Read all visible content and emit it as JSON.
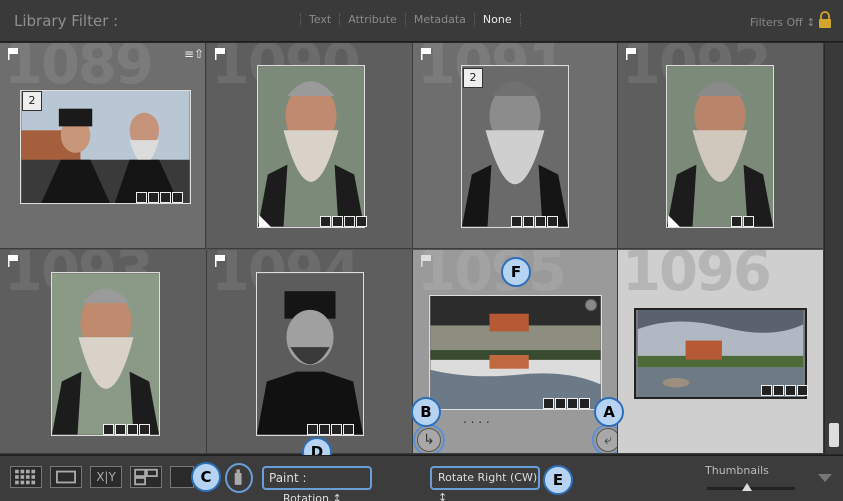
{
  "filterbar": {
    "title": "Library Filter :",
    "tabs": [
      {
        "label": "Text",
        "active": false
      },
      {
        "label": "Attribute",
        "active": false
      },
      {
        "label": "Metadata",
        "active": false
      },
      {
        "label": "None",
        "active": true
      }
    ],
    "filters_off": "Filters Off ↕",
    "lock_icon": "lock-icon"
  },
  "grid": {
    "cells": [
      {
        "index": "1089",
        "stack_count": "2",
        "tone": "light"
      },
      {
        "index": "1090",
        "stack_count": "",
        "tone": "dark"
      },
      {
        "index": "1091",
        "stack_count": "2",
        "tone": "light"
      },
      {
        "index": "1092",
        "stack_count": "",
        "tone": "dark"
      },
      {
        "index": "1093",
        "stack_count": "",
        "tone": "dark"
      },
      {
        "index": "1094",
        "stack_count": "",
        "tone": "dark"
      },
      {
        "index": "1095",
        "stack_count": "",
        "tone": "hover"
      },
      {
        "index": "1096",
        "stack_count": "",
        "tone": "selected"
      }
    ]
  },
  "callouts": {
    "a": "A",
    "b": "B",
    "c": "C",
    "d": "D",
    "e": "E",
    "f": "F"
  },
  "misc": {
    "ellipsis": ". . . ."
  },
  "toolbar": {
    "paint_label": "Paint :",
    "paint_value": "Rotation ↕",
    "rotate_value": "Rotate Right (CW) ↕",
    "thumbnails_label": "Thumbnails",
    "thumbnail_size": 0.45
  },
  "colors": {
    "accent": "#6a9ed9",
    "callout_fill": "#b6d4f2",
    "callout_border": "#2d6eb8",
    "selected_cell": "#cfcfcf"
  }
}
